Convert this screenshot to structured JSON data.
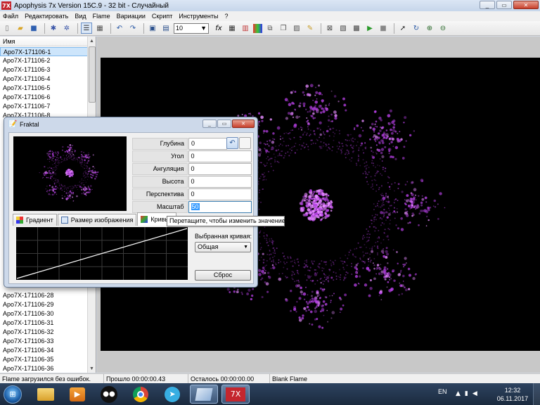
{
  "window": {
    "title": "Apophysis 7x Version 15C.9  - 32 bit - Случайный",
    "icon_text": "7X"
  },
  "menu": [
    "Файл",
    "Редактировать",
    "Вид",
    "Flame",
    "Вариации",
    "Скрипт",
    "Инструменты",
    "?"
  ],
  "toolbar": {
    "combo_value": "10",
    "icons": [
      "new-icon",
      "open-icon",
      "save-icon",
      "render-icon",
      "batch-icon",
      "list-view-icon",
      "icon-view-icon",
      "undo-icon",
      "redo-icon",
      "fullscreen-icon",
      "preview-icon",
      "formula-icon",
      "table-icon",
      "gradient-icon",
      "size-icon",
      "copy-icon",
      "paste-icon",
      "mutate-icon",
      "adjust-icon",
      "curves-icon",
      "play-icon",
      "stop-icon",
      "pointer-icon",
      "rotate-icon",
      "zoom-in-icon",
      "zoom-out-icon"
    ]
  },
  "list": {
    "header": "Имя",
    "items_top": [
      "Apo7X-171106-1",
      "Apo7X-171106-2",
      "Apo7X-171106-3",
      "Apo7X-171106-4",
      "Apo7X-171106-5",
      "Apo7X-171106-6",
      "Apo7X-171106-7",
      "Apo7X-171106-8"
    ],
    "items_bottom": [
      "Apo7X-171106-28",
      "Apo7X-171106-29",
      "Apo7X-171106-30",
      "Apo7X-171106-31",
      "Apo7X-171106-32",
      "Apo7X-171106-33",
      "Apo7X-171106-34",
      "Apo7X-171106-35",
      "Apo7X-171106-36"
    ],
    "selected_index": 0
  },
  "status": {
    "message": "Flame загрузился без ошибок.",
    "elapsed": "Прошло 00:00:00.43",
    "remaining": "Осталось 00:00:00.00",
    "name": "Blank Flame"
  },
  "dialog": {
    "title": "Fraktal",
    "props": [
      {
        "label": "Глубина резкости",
        "value": "0"
      },
      {
        "label": "Угол",
        "value": "0"
      },
      {
        "label": "Ангуляция",
        "value": "0"
      },
      {
        "label": "Высота",
        "value": "0"
      },
      {
        "label": "Перспектива",
        "value": "0"
      },
      {
        "label": "Масштаб",
        "value": "50"
      }
    ],
    "tabs": [
      "Градиент",
      "Размер изображения",
      "Кривые"
    ],
    "active_tab": 2,
    "curve_label": "Выбранная кривая:",
    "curve_select": "Общая",
    "reset_label": "Сброс",
    "tooltip": "Перетащите, чтобы изменить значение"
  },
  "taskbar": {
    "lang": "EN",
    "time": "12:32",
    "date": "06.11.2017",
    "apps": [
      "folder-icon",
      "media-player-icon",
      "eyes-app-icon",
      "chrome-icon",
      "telegram-icon",
      "window-icon",
      "apophysis-icon"
    ],
    "active_app_label": "7X"
  },
  "colors": {
    "fractal": "#b23ee0",
    "fractal_core": "#e58bff",
    "canvas": "#000000",
    "accent": "#3399ff"
  }
}
